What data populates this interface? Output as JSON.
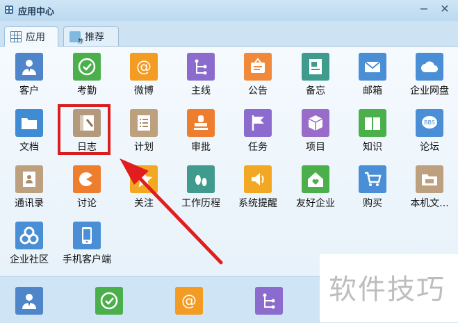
{
  "window": {
    "title": "应用中心",
    "min": "−",
    "close": "✕"
  },
  "tabs": [
    {
      "label": "应用",
      "icon": "grid-icon",
      "active": true
    },
    {
      "label": "推荐",
      "icon": "recommend-icon",
      "active": false
    }
  ],
  "apps": [
    {
      "label": "客户",
      "icon": "person-icon",
      "color": "#4e86c9"
    },
    {
      "label": "考勤",
      "icon": "clock-check-icon",
      "color": "#4bb04c"
    },
    {
      "label": "微博",
      "icon": "at-icon",
      "color": "#f39b23"
    },
    {
      "label": "主线",
      "icon": "branch-icon",
      "color": "#8c6bcf"
    },
    {
      "label": "公告",
      "icon": "notice-board-icon",
      "color": "#f08a3a"
    },
    {
      "label": "备忘",
      "icon": "memo-icon",
      "color": "#3e9b8e"
    },
    {
      "label": "邮箱",
      "icon": "mail-icon",
      "color": "#4a8fd6"
    },
    {
      "label": "企业网盘",
      "icon": "cloud-icon",
      "color": "#4a8fd6"
    },
    {
      "label": "文档",
      "icon": "folder-icon",
      "color": "#3f8bd4"
    },
    {
      "label": "日志",
      "icon": "journal-icon",
      "color": "#b39a7c"
    },
    {
      "label": "计划",
      "icon": "checklist-icon",
      "color": "#bda07d"
    },
    {
      "label": "审批",
      "icon": "stamp-icon",
      "color": "#ef7d2e"
    },
    {
      "label": "任务",
      "icon": "flag-icon",
      "color": "#8c6bcf"
    },
    {
      "label": "项目",
      "icon": "box-icon",
      "color": "#9a6cc9"
    },
    {
      "label": "知识",
      "icon": "book-icon",
      "color": "#4bb04c"
    },
    {
      "label": "论坛",
      "icon": "bbs-icon",
      "color": "#4a8fd6"
    },
    {
      "label": "通讯录",
      "icon": "contacts-icon",
      "color": "#bda07d"
    },
    {
      "label": "讨论",
      "icon": "discuss-icon",
      "color": "#ef7d2e"
    },
    {
      "label": "关注",
      "icon": "star-icon",
      "color": "#f3a823"
    },
    {
      "label": "工作历程",
      "icon": "footprint-icon",
      "color": "#3e9b8e"
    },
    {
      "label": "系统提醒",
      "icon": "speaker-icon",
      "color": "#f3a823"
    },
    {
      "label": "友好企业",
      "icon": "home-heart-icon",
      "color": "#4bb04c"
    },
    {
      "label": "购买",
      "icon": "cart-icon",
      "color": "#4a8fd6"
    },
    {
      "label": "本机文...",
      "icon": "local-folder-icon",
      "color": "#bda07d"
    },
    {
      "label": "企业社区",
      "icon": "community-icon",
      "color": "#4a8fd6"
    },
    {
      "label": "手机客户端",
      "icon": "phone-icon",
      "color": "#4a8fd6"
    }
  ],
  "dock": [
    {
      "icon": "person-icon",
      "color": "#4e86c9"
    },
    {
      "icon": "clock-check-icon",
      "color": "#4bb04c"
    },
    {
      "icon": "at-icon",
      "color": "#f39b23"
    },
    {
      "icon": "branch-icon",
      "color": "#8c6bcf"
    }
  ],
  "watermark": "软件技巧",
  "annotation": {
    "highlight_color": "#d81e1e"
  }
}
